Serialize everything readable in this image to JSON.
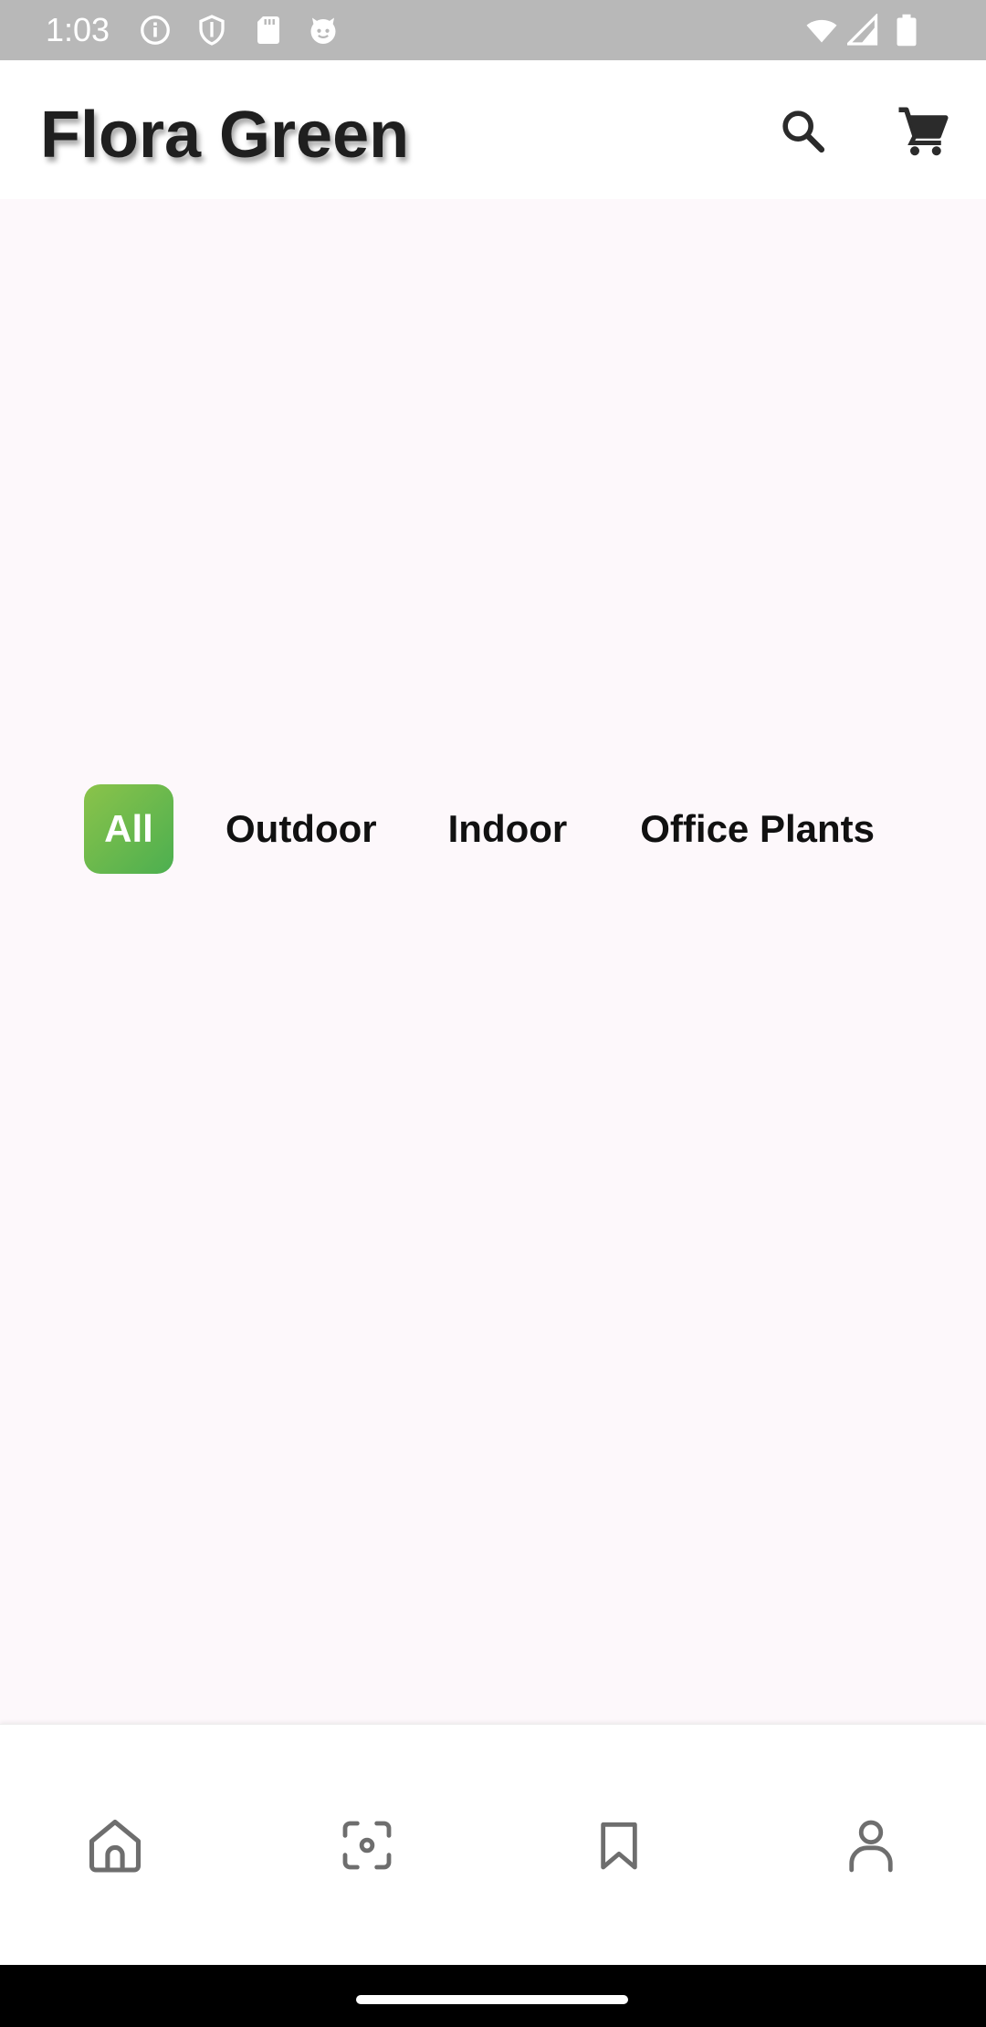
{
  "status_bar": {
    "time": "1:03",
    "left_icons": [
      "info-icon",
      "shield-icon",
      "sd-card-icon",
      "face-icon"
    ],
    "right_icons": [
      "wifi-icon",
      "signal-icon",
      "battery-icon"
    ]
  },
  "app_bar": {
    "title": "Flora Green",
    "actions": [
      "search-icon",
      "cart-icon"
    ]
  },
  "categories": {
    "items": [
      "All",
      "Outdoor",
      "Indoor",
      "Office Plants"
    ],
    "selected": "All"
  },
  "bottom_nav": {
    "items": [
      "home-icon",
      "scan-icon",
      "bookmark-icon",
      "profile-icon"
    ]
  },
  "colors": {
    "accent_start": "#8bc34a",
    "accent_end": "#4caf50",
    "background": "#fdf8fb",
    "status_bar": "#b8b8b8"
  }
}
